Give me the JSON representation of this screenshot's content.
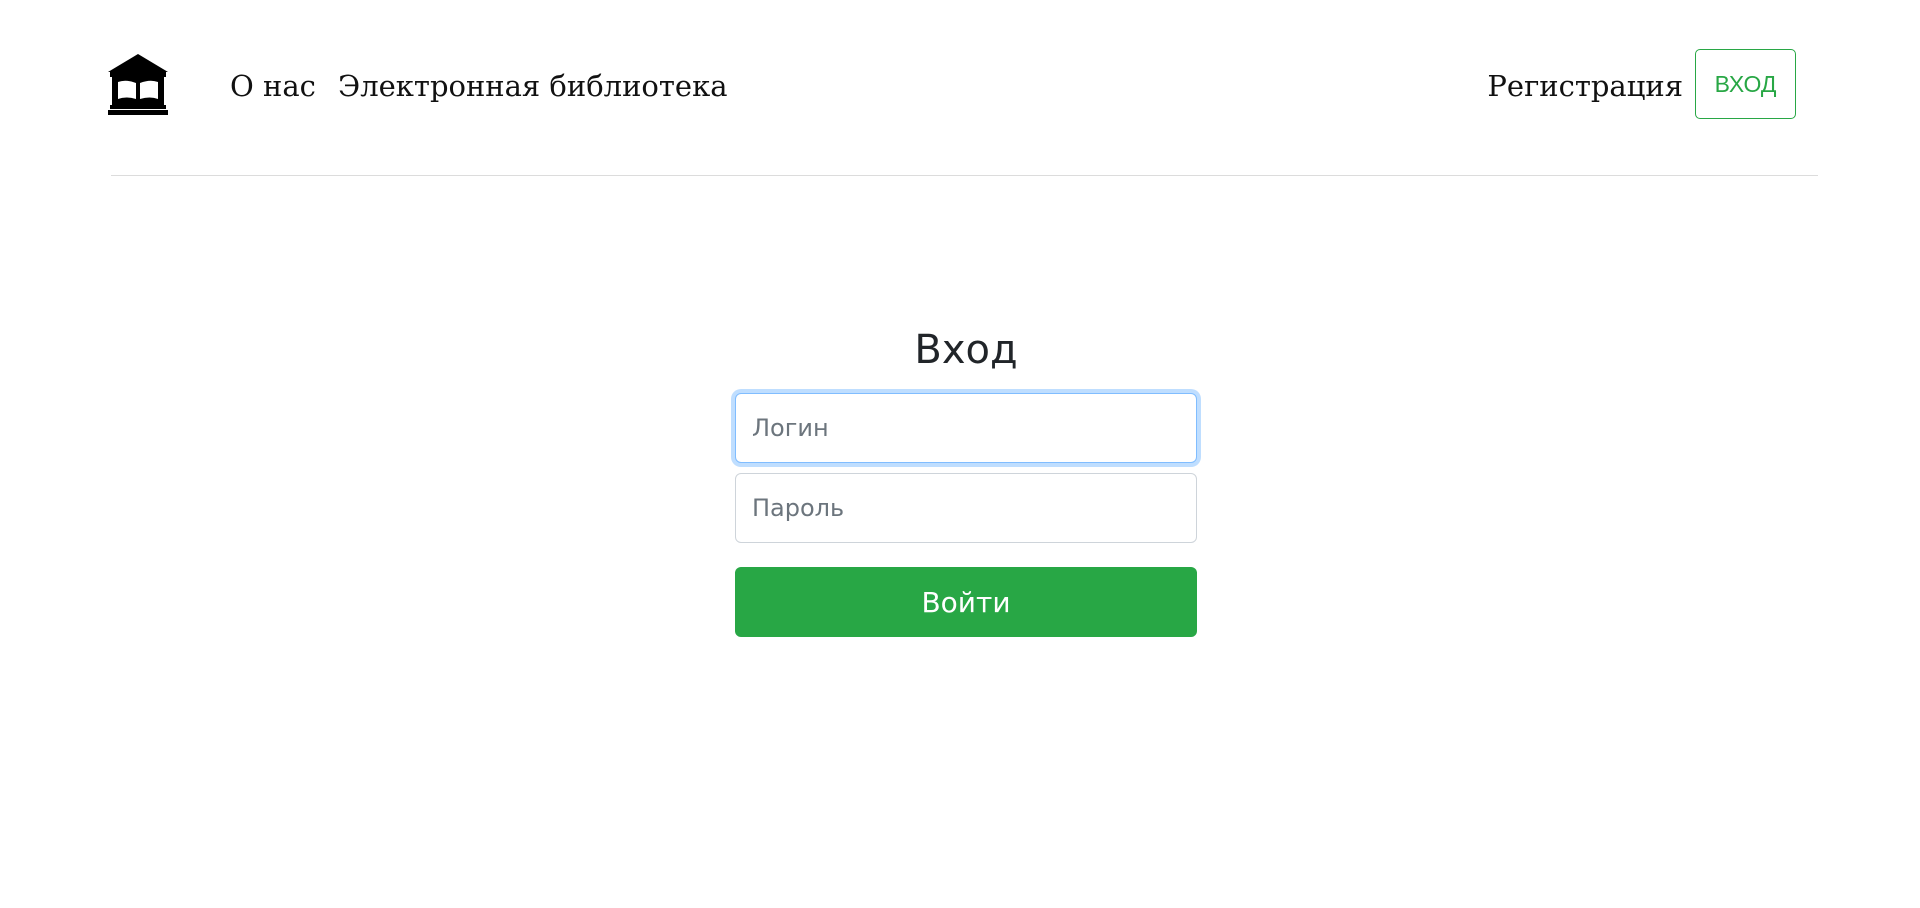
{
  "header": {
    "logo_icon": "library-building-icon",
    "nav": {
      "about": "О нас",
      "library": "Электронная библиотека"
    },
    "register_label": "Регистрация",
    "login_label": "ВХОД"
  },
  "form": {
    "title": "Вход",
    "login_placeholder": "Логин",
    "login_value": "",
    "password_placeholder": "Пароль",
    "password_value": "",
    "submit_label": "Войти"
  },
  "colors": {
    "accent_green": "#28a745",
    "focus_border": "#80bdff",
    "divider": "#dcdcdc",
    "text": "#212529"
  }
}
